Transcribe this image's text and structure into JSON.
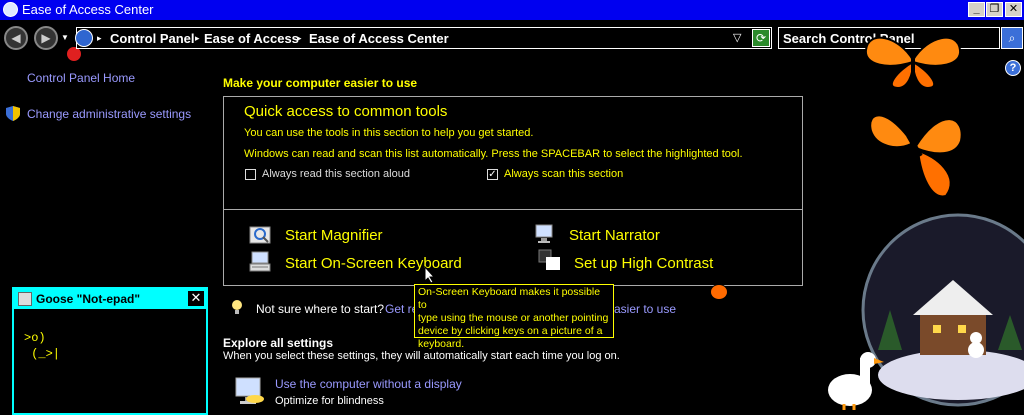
{
  "window": {
    "title": "Ease of Access Center",
    "minimize_icon": "minimize-icon",
    "restore_icon": "restore-icon",
    "close_icon": "close-icon"
  },
  "address": {
    "breadcrumbs": [
      "Control Panel",
      "Ease of Access",
      "Ease of Access Center"
    ],
    "search_placeholder": "Search Control Panel"
  },
  "sidebar": {
    "home": "Control Panel Home",
    "admin": "Change administrative settings"
  },
  "main": {
    "heading": "Make your computer easier to use",
    "quick_access": {
      "title": "Quick access to common tools",
      "desc1": "You can use the tools in this section to help you get started.",
      "desc2": "Windows can read and scan this list automatically.  Press the SPACEBAR to select the highlighted tool.",
      "checkbox_read": {
        "label": "Always read this section aloud",
        "checked": false
      },
      "checkbox_scan": {
        "label": "Always scan this section",
        "checked": true
      },
      "tools": [
        {
          "label": "Start Magnifier",
          "icon": "magnifier-icon"
        },
        {
          "label": "Start Narrator",
          "icon": "narrator-icon"
        },
        {
          "label": "Start On-Screen Keyboard",
          "icon": "keyboard-icon"
        },
        {
          "label": "Set up High Contrast",
          "icon": "high-contrast-icon"
        }
      ]
    },
    "not_sure_prefix": "Not sure where to start?",
    "not_sure_link_start": "Get re",
    "not_sure_link_end": "asier to use",
    "explore_heading": "Explore all settings",
    "explore_desc": "When you select these settings, they will automatically start each time you log on.",
    "settings": [
      {
        "title": "Use the computer without a display",
        "subtitle": "Optimize for blindness"
      }
    ]
  },
  "tooltip": {
    "line1": "On-Screen Keyboard makes it possible to",
    "line2": "type using the mouse or another pointing",
    "line3": "device by clicking keys on a picture of a",
    "line4": "keyboard."
  },
  "goose_window": {
    "title": "Goose \"Not-epad\"",
    "content": ">o)\n (_>|"
  }
}
